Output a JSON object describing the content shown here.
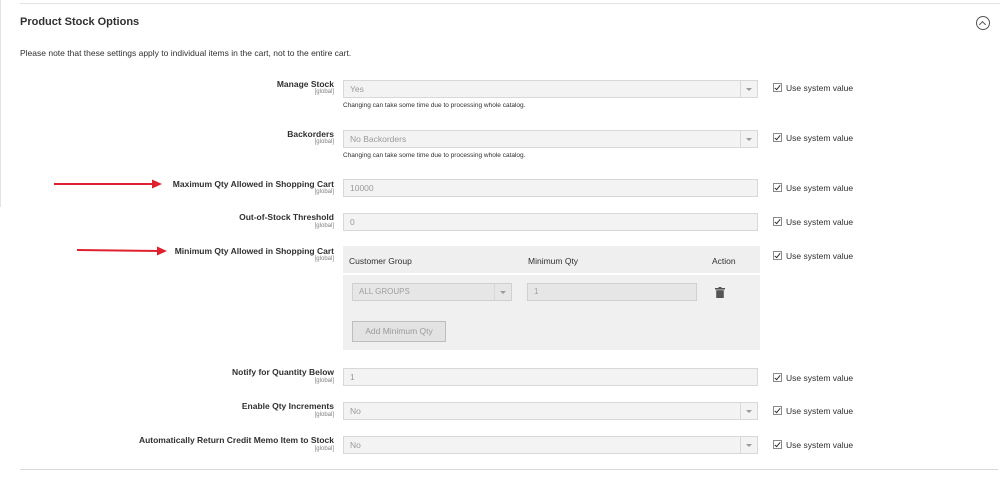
{
  "section": {
    "title": "Product Stock Options",
    "note": "Please note that these settings apply to individual items in the cart, not to the entire cart.",
    "collapse_icon": "chevron-up-circle-icon"
  },
  "scope_text": "[global]",
  "use_system_label": "Use system value",
  "fields": {
    "manage_stock": {
      "label": "Manage Stock",
      "value": "Yes",
      "hint": "Changing can take some time due to processing whole catalog."
    },
    "backorders": {
      "label": "Backorders",
      "value": "No Backorders",
      "hint": "Changing can take some time due to processing whole catalog."
    },
    "max_qty": {
      "label": "Maximum Qty Allowed in Shopping Cart",
      "value": "10000"
    },
    "out_of_stock": {
      "label": "Out-of-Stock Threshold",
      "value": "0"
    },
    "min_qty": {
      "label": "Minimum Qty Allowed in Shopping Cart",
      "table": {
        "headers": [
          "Customer Group",
          "Minimum Qty",
          "Action"
        ],
        "row": {
          "group": "ALL GROUPS",
          "qty": "1"
        },
        "add_button": "Add Minimum Qty"
      }
    },
    "notify_below": {
      "label": "Notify for Quantity Below",
      "value": "1"
    },
    "qty_increments": {
      "label": "Enable Qty Increments",
      "value": "No"
    },
    "return_credit": {
      "label": "Automatically Return Credit Memo Item to Stock",
      "value": "No"
    }
  },
  "colors": {
    "annotation_arrow": "#e0202e",
    "field_bg": "#f3f3f3",
    "border": "#d8d8d8"
  }
}
